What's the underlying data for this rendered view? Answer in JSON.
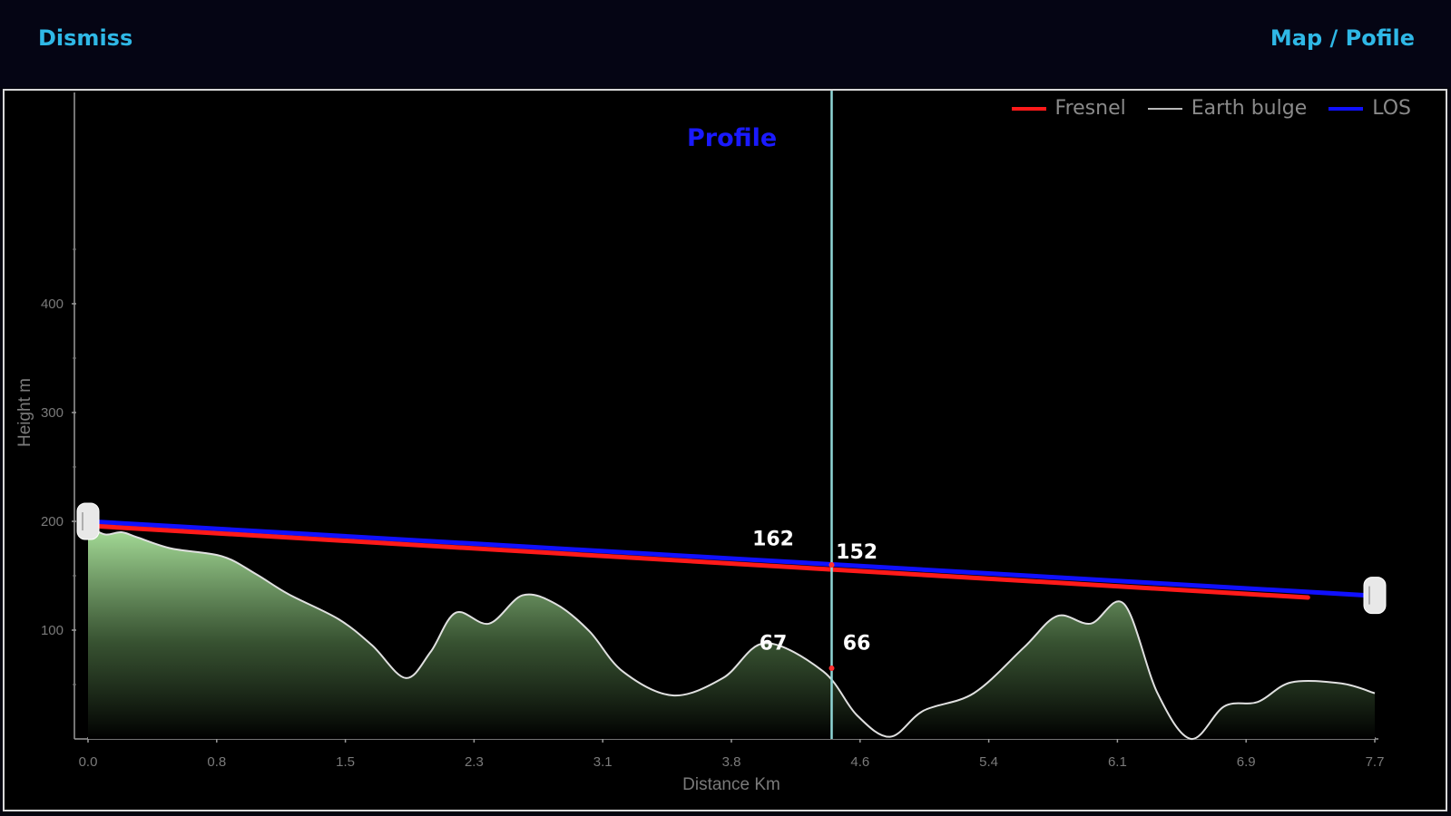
{
  "header": {
    "dismiss_label": "Dismiss",
    "map_profile_label": "Map / Pofile"
  },
  "colors": {
    "header_bg": "#050514",
    "header_text": "#2fb8e6",
    "chart_bg": "#000000",
    "title": "#1a1aff",
    "fresnel": "#ff1a1a",
    "earth_bulge": "#b8b8b8",
    "los": "#1010ff",
    "cursor": "#8fd6d6",
    "terrain_fill_top": "#a8e09a",
    "terrain_stroke": "#e0e0e0"
  },
  "chart_data": {
    "type": "area",
    "title": "Profile",
    "xlabel": "Distance Km",
    "ylabel": "Height m",
    "x_ticks": [
      "0.0",
      "0.8",
      "1.5",
      "2.3",
      "3.1",
      "3.8",
      "4.6",
      "5.4",
      "6.1",
      "6.9",
      "7.7"
    ],
    "x_range": [
      0,
      7.7
    ],
    "y_ticks": [
      100,
      200,
      300,
      400
    ],
    "y_range": [
      0,
      590
    ],
    "legend": {
      "position": "top-right",
      "entries": [
        {
          "name": "Fresnel",
          "color": "#ff1a1a"
        },
        {
          "name": "Earth bulge",
          "color": "#b8b8b8"
        },
        {
          "name": "LOS",
          "color": "#1010ff"
        }
      ]
    },
    "series": [
      {
        "name": "LOS",
        "color": "#1010ff",
        "x": [
          0.0,
          7.65
        ],
        "y": [
          200,
          132
        ]
      },
      {
        "name": "Fresnel",
        "color": "#ff1a1a",
        "x": [
          0.0,
          7.3
        ],
        "y": [
          196,
          130
        ]
      }
    ],
    "terrain": {
      "x": [
        0.0,
        0.1,
        0.2,
        0.3,
        0.5,
        0.8,
        1.0,
        1.2,
        1.5,
        1.7,
        1.9,
        2.05,
        2.2,
        2.4,
        2.6,
        2.8,
        3.0,
        3.2,
        3.5,
        3.8,
        4.05,
        4.4,
        4.6,
        4.8,
        5.0,
        5.3,
        5.6,
        5.8,
        6.0,
        6.2,
        6.4,
        6.6,
        6.8,
        7.0,
        7.2,
        7.5,
        7.7
      ],
      "y": [
        196,
        188,
        190,
        185,
        175,
        168,
        152,
        133,
        110,
        86,
        56,
        80,
        116,
        106,
        132,
        124,
        99,
        62,
        40,
        56,
        88,
        62,
        22,
        2,
        26,
        42,
        84,
        113,
        106,
        124,
        42,
        0,
        30,
        34,
        52,
        51,
        42
      ]
    },
    "cursor": {
      "x": 4.45
    },
    "annotations": [
      {
        "text": "162",
        "x": 4.1,
        "y": 178,
        "series": "LOS"
      },
      {
        "text": "152",
        "x": 4.6,
        "y": 166,
        "series": "Fresnel"
      },
      {
        "text": "67",
        "x": 4.1,
        "y": 82,
        "series": "terrain"
      },
      {
        "text": "66",
        "x": 4.6,
        "y": 82,
        "series": "terrain"
      }
    ],
    "grid": false
  }
}
